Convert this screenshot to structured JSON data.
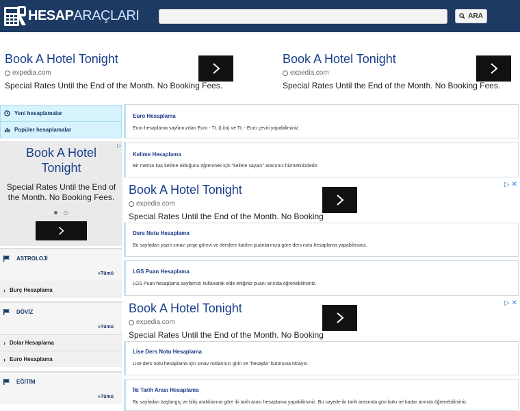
{
  "header": {
    "logo_main": "HESAP",
    "logo_accent": "ARAÇLARI",
    "search_placeholder": "",
    "search_button": "ARA"
  },
  "ads": {
    "title": "Book A Hotel Tonight",
    "source": "expedia.com",
    "text": "Special Rates Until the End of the Month. No Booking Fees.",
    "side_title": "Book A Hotel Tonight",
    "side_text": "Special Rates Until the End of the Month. No Booking Fees.",
    "marker": "▷ ✕"
  },
  "sidebar": {
    "tabs": [
      {
        "label": "Yeni hesaplamalar"
      },
      {
        "label": "Popüler hesaplamalar"
      }
    ],
    "categories": [
      {
        "title": "ASTROLOJİ",
        "all": "»Tümü",
        "items": [
          "Burç Hesaplama"
        ]
      },
      {
        "title": "DÖVİZ",
        "all": "»Tümü",
        "items": [
          "Dolar Hesaplama",
          "Euro Hesaplama"
        ]
      },
      {
        "title": "EĞİTİM",
        "all": "»Tümü",
        "items": []
      }
    ]
  },
  "cards": [
    {
      "title": "Euro Hesaplama",
      "desc": "Euro hesaplama sayfamızdan Euro - TL (Lira) ve TL - Euro çeviri yapabilirsiniz."
    },
    {
      "title": "Kelime Hesaplama",
      "desc": "Bir metnin kaç kelime olduğunu öğrenmek için \"kelime sayacı\" aracımız hizmetinizdedir."
    },
    {
      "title": "Ders Notu Hesaplama",
      "desc": "Bu sayfadan yazılı sınav, proje görevi ve derslere katılım puanlarınıza göre ders notu hesaplama yapabilirsiniz."
    },
    {
      "title": "LGS Puan Hesaplama",
      "desc": "LGS Puan hesaplama sayfamızı kullanarak elde ettiğiniz puanı anında öğrenebilirsiniz."
    },
    {
      "title": "Lise Ders Notu Hesaplama",
      "desc": "Lise ders notu hesaplama için sınav notlarınızı girin ve \"hesapla\" butonuna tıklayın."
    },
    {
      "title": "İki Tarih Arası Hesaplama",
      "desc": "Bu sayfadan başlangıç ve bitiş aralıklarına göre iki tarih arası hesaplama yapabilirsiniz. Bu sayede iki tarih arasında gün farkı ne kadar anında öğrenebilirsiniz."
    }
  ],
  "colors": {
    "header_bg": "#1d3a63",
    "link": "#1d3a8a",
    "tab_bg": "#d7f3fd"
  }
}
